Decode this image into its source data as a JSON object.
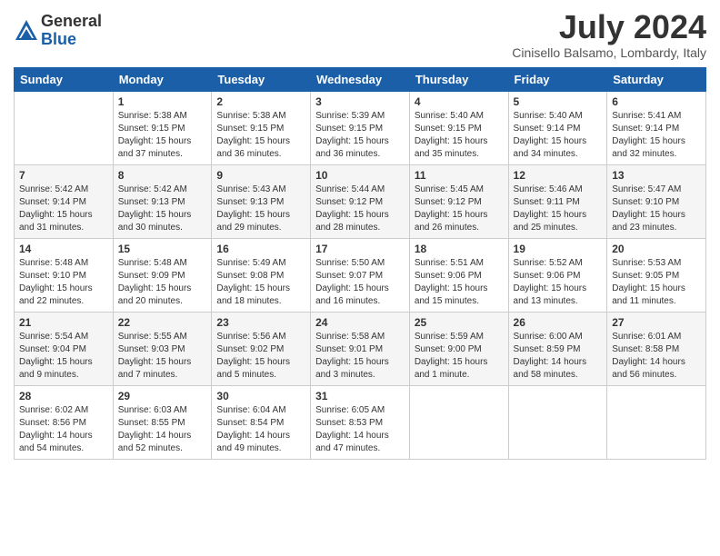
{
  "header": {
    "logo_general": "General",
    "logo_blue": "Blue",
    "month_year": "July 2024",
    "location": "Cinisello Balsamo, Lombardy, Italy"
  },
  "days_of_week": [
    "Sunday",
    "Monday",
    "Tuesday",
    "Wednesday",
    "Thursday",
    "Friday",
    "Saturday"
  ],
  "weeks": [
    [
      {
        "day": "",
        "info": ""
      },
      {
        "day": "1",
        "info": "Sunrise: 5:38 AM\nSunset: 9:15 PM\nDaylight: 15 hours\nand 37 minutes."
      },
      {
        "day": "2",
        "info": "Sunrise: 5:38 AM\nSunset: 9:15 PM\nDaylight: 15 hours\nand 36 minutes."
      },
      {
        "day": "3",
        "info": "Sunrise: 5:39 AM\nSunset: 9:15 PM\nDaylight: 15 hours\nand 36 minutes."
      },
      {
        "day": "4",
        "info": "Sunrise: 5:40 AM\nSunset: 9:15 PM\nDaylight: 15 hours\nand 35 minutes."
      },
      {
        "day": "5",
        "info": "Sunrise: 5:40 AM\nSunset: 9:14 PM\nDaylight: 15 hours\nand 34 minutes."
      },
      {
        "day": "6",
        "info": "Sunrise: 5:41 AM\nSunset: 9:14 PM\nDaylight: 15 hours\nand 32 minutes."
      }
    ],
    [
      {
        "day": "7",
        "info": "Sunrise: 5:42 AM\nSunset: 9:14 PM\nDaylight: 15 hours\nand 31 minutes."
      },
      {
        "day": "8",
        "info": "Sunrise: 5:42 AM\nSunset: 9:13 PM\nDaylight: 15 hours\nand 30 minutes."
      },
      {
        "day": "9",
        "info": "Sunrise: 5:43 AM\nSunset: 9:13 PM\nDaylight: 15 hours\nand 29 minutes."
      },
      {
        "day": "10",
        "info": "Sunrise: 5:44 AM\nSunset: 9:12 PM\nDaylight: 15 hours\nand 28 minutes."
      },
      {
        "day": "11",
        "info": "Sunrise: 5:45 AM\nSunset: 9:12 PM\nDaylight: 15 hours\nand 26 minutes."
      },
      {
        "day": "12",
        "info": "Sunrise: 5:46 AM\nSunset: 9:11 PM\nDaylight: 15 hours\nand 25 minutes."
      },
      {
        "day": "13",
        "info": "Sunrise: 5:47 AM\nSunset: 9:10 PM\nDaylight: 15 hours\nand 23 minutes."
      }
    ],
    [
      {
        "day": "14",
        "info": "Sunrise: 5:48 AM\nSunset: 9:10 PM\nDaylight: 15 hours\nand 22 minutes."
      },
      {
        "day": "15",
        "info": "Sunrise: 5:48 AM\nSunset: 9:09 PM\nDaylight: 15 hours\nand 20 minutes."
      },
      {
        "day": "16",
        "info": "Sunrise: 5:49 AM\nSunset: 9:08 PM\nDaylight: 15 hours\nand 18 minutes."
      },
      {
        "day": "17",
        "info": "Sunrise: 5:50 AM\nSunset: 9:07 PM\nDaylight: 15 hours\nand 16 minutes."
      },
      {
        "day": "18",
        "info": "Sunrise: 5:51 AM\nSunset: 9:06 PM\nDaylight: 15 hours\nand 15 minutes."
      },
      {
        "day": "19",
        "info": "Sunrise: 5:52 AM\nSunset: 9:06 PM\nDaylight: 15 hours\nand 13 minutes."
      },
      {
        "day": "20",
        "info": "Sunrise: 5:53 AM\nSunset: 9:05 PM\nDaylight: 15 hours\nand 11 minutes."
      }
    ],
    [
      {
        "day": "21",
        "info": "Sunrise: 5:54 AM\nSunset: 9:04 PM\nDaylight: 15 hours\nand 9 minutes."
      },
      {
        "day": "22",
        "info": "Sunrise: 5:55 AM\nSunset: 9:03 PM\nDaylight: 15 hours\nand 7 minutes."
      },
      {
        "day": "23",
        "info": "Sunrise: 5:56 AM\nSunset: 9:02 PM\nDaylight: 15 hours\nand 5 minutes."
      },
      {
        "day": "24",
        "info": "Sunrise: 5:58 AM\nSunset: 9:01 PM\nDaylight: 15 hours\nand 3 minutes."
      },
      {
        "day": "25",
        "info": "Sunrise: 5:59 AM\nSunset: 9:00 PM\nDaylight: 15 hours\nand 1 minute."
      },
      {
        "day": "26",
        "info": "Sunrise: 6:00 AM\nSunset: 8:59 PM\nDaylight: 14 hours\nand 58 minutes."
      },
      {
        "day": "27",
        "info": "Sunrise: 6:01 AM\nSunset: 8:58 PM\nDaylight: 14 hours\nand 56 minutes."
      }
    ],
    [
      {
        "day": "28",
        "info": "Sunrise: 6:02 AM\nSunset: 8:56 PM\nDaylight: 14 hours\nand 54 minutes."
      },
      {
        "day": "29",
        "info": "Sunrise: 6:03 AM\nSunset: 8:55 PM\nDaylight: 14 hours\nand 52 minutes."
      },
      {
        "day": "30",
        "info": "Sunrise: 6:04 AM\nSunset: 8:54 PM\nDaylight: 14 hours\nand 49 minutes."
      },
      {
        "day": "31",
        "info": "Sunrise: 6:05 AM\nSunset: 8:53 PM\nDaylight: 14 hours\nand 47 minutes."
      },
      {
        "day": "",
        "info": ""
      },
      {
        "day": "",
        "info": ""
      },
      {
        "day": "",
        "info": ""
      }
    ]
  ]
}
